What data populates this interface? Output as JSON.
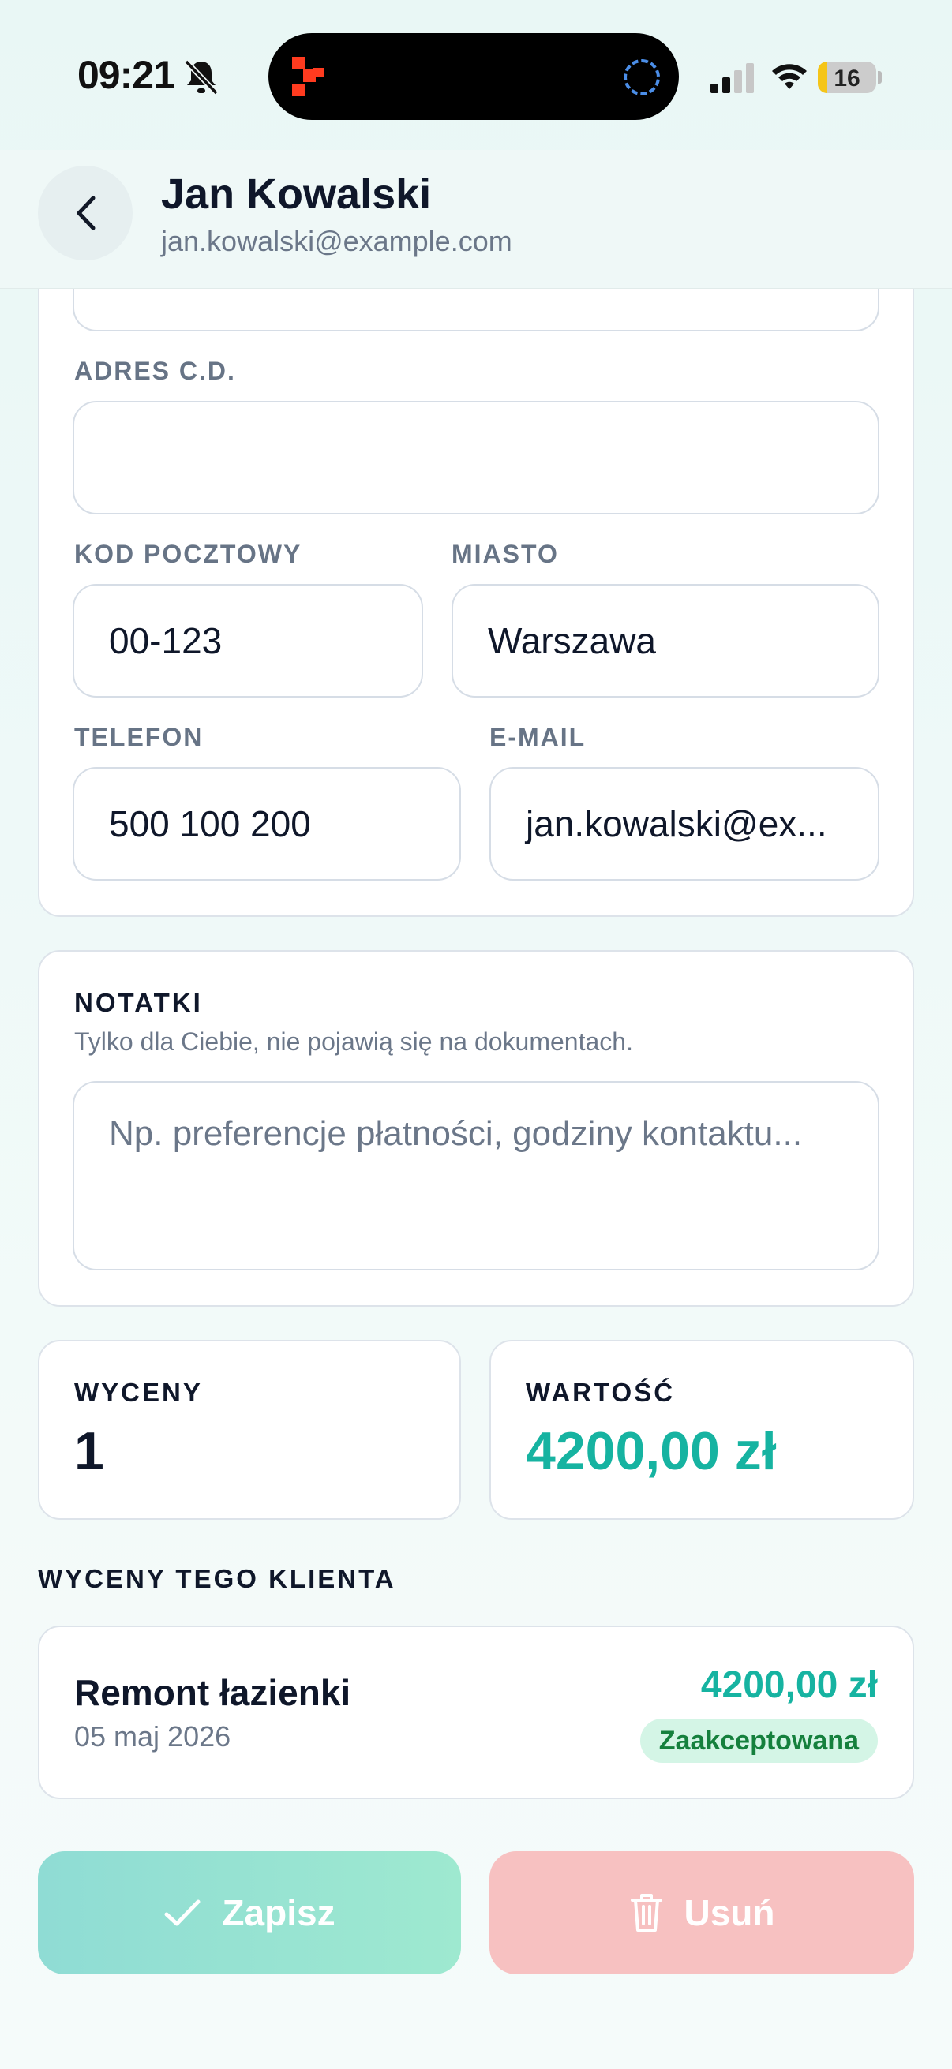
{
  "status": {
    "time": "09:21",
    "battery": "16",
    "battery_level": 0.16
  },
  "header": {
    "name": "Jan Kowalski",
    "email": "jan.kowalski@example.com"
  },
  "form": {
    "address2_label": "ADRES C.D.",
    "address2_value": "",
    "postal_label": "KOD POCZTOWY",
    "postal_value": "00-123",
    "city_label": "MIASTO",
    "city_value": "Warszawa",
    "phone_label": "TELEFON",
    "phone_value": "500 100 200",
    "email_label": "E-MAIL",
    "email_value": "jan.kowalski@ex..."
  },
  "notes": {
    "title": "NOTATKI",
    "subtitle": "Tylko dla Ciebie, nie pojawią się na dokumentach.",
    "placeholder": "Np. preferencje płatności, godziny kontaktu..."
  },
  "stats": {
    "quotes_label": "WYCENY",
    "quotes_value": "1",
    "value_label": "WARTOŚĆ",
    "value_amount": "4200,00 zł"
  },
  "client_quotes": {
    "title": "WYCENY TEGO KLIENTA",
    "items": [
      {
        "name": "Remont łazienki",
        "date": "05 maj 2026",
        "amount": "4200,00 zł",
        "status": "Zaakceptowana"
      }
    ]
  },
  "actions": {
    "save_label": "Zapisz",
    "delete_label": "Usuń"
  },
  "colors": {
    "accent": "#16b3a1",
    "status_bg": "#d4f5e6",
    "status_text": "#15803d",
    "delete": "#f7c1c1"
  }
}
